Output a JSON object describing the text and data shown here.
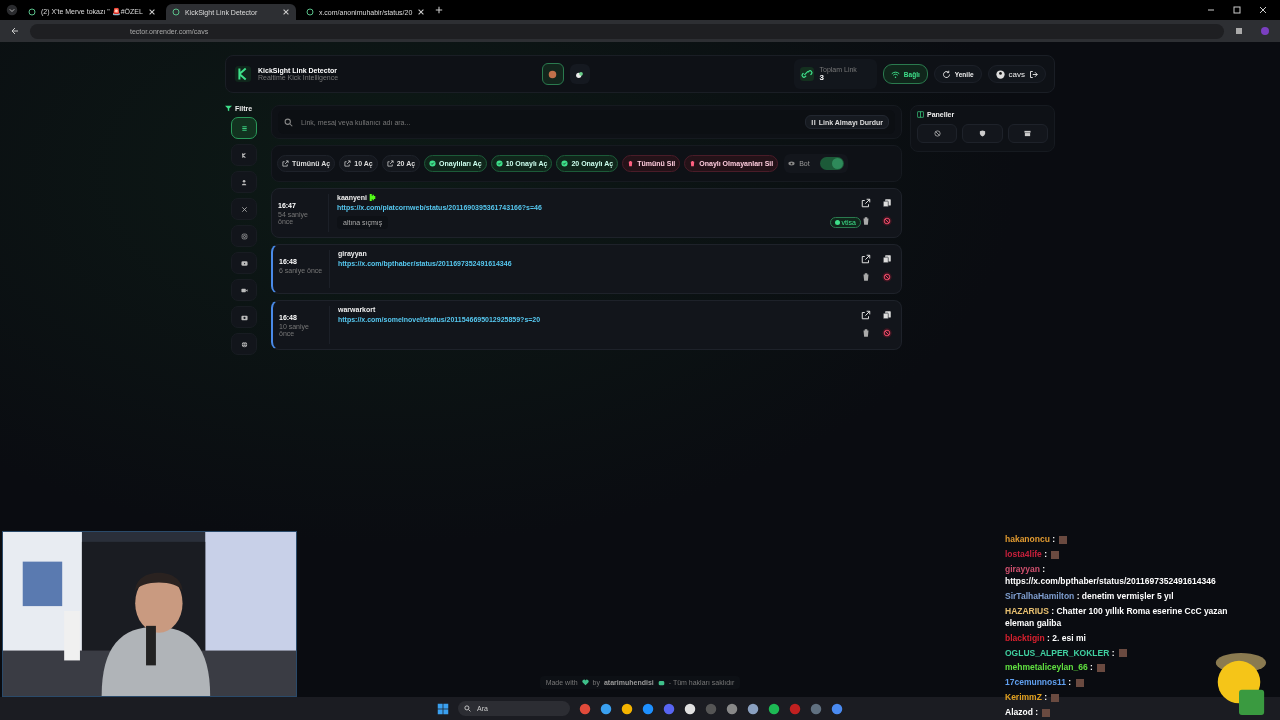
{
  "browser": {
    "tabs": [
      {
        "title": "(2) X'te Merve tokazı \" 🚨#ÖZEL",
        "selected": false
      },
      {
        "title": "KickSight Link Detector",
        "selected": true
      },
      {
        "title": "x.com/anonimuhabir/status/20",
        "selected": false
      }
    ],
    "address": "tector.onrender.com/cavs"
  },
  "header": {
    "title": "KickSight Link Detector",
    "subtitle": "Realtime Kick Intelligence",
    "stat_label": "Toplam Link",
    "stat_value": "3",
    "status": "Bağlı",
    "refresh": "Yenile",
    "user": "cavs"
  },
  "filter_title": "Filtre",
  "filters": [
    {
      "selected": true
    },
    {
      "selected": false
    },
    {
      "selected": false
    },
    {
      "selected": false
    },
    {
      "selected": false
    },
    {
      "selected": false
    },
    {
      "selected": false
    },
    {
      "selected": false
    },
    {
      "selected": false
    }
  ],
  "search": {
    "placeholder": "Link, mesaj veya kullanıcı adı ara...",
    "stop_button": "Link Almayı Durdur"
  },
  "actions": [
    {
      "label": "Tümünü Aç",
      "kind": "open"
    },
    {
      "label": "10 Aç",
      "kind": "open"
    },
    {
      "label": "20 Aç",
      "kind": "open"
    },
    {
      "label": "Onaylıları Aç",
      "kind": "approved"
    },
    {
      "label": "10 Onaylı Aç",
      "kind": "approved"
    },
    {
      "label": "20 Onaylı Aç",
      "kind": "approved"
    },
    {
      "label": "Tümünü Sil",
      "kind": "delete"
    },
    {
      "label": "Onaylı Olmayanları Sil",
      "kind": "delete"
    }
  ],
  "bot": {
    "label": "Bot",
    "on": true
  },
  "panels_title": "Paneller",
  "links": [
    {
      "time": "16:47",
      "ago": "54 saniye önce",
      "user": "kaanyeni",
      "verified": true,
      "url": "https://x.com/platcornweb/status/2011690395361743166?s=46",
      "note": "altına sıçmış",
      "badge": "vtisa",
      "unread": false
    },
    {
      "time": "16:48",
      "ago": "6 saniye önce",
      "user": "girayyan",
      "verified": false,
      "url": "https://x.com/bpthaber/status/2011697352491614346",
      "unread": true
    },
    {
      "time": "16:48",
      "ago": "10 saniye önce",
      "user": "warwarkort",
      "verified": false,
      "url": "https://x.com/somelnovel/status/2011546695012925859?s=20",
      "unread": true
    }
  ],
  "footer": {
    "made_with": "Made with",
    "by": "by",
    "author": "atarimuhendisi",
    "rights": "- Tüm hakları saklıdır"
  },
  "chat": [
    {
      "user": "hakanoncu",
      "sep": ":",
      "color": "#e09a30",
      "emote": true
    },
    {
      "user": "losta4life",
      "sep": ":",
      "color": "#c8203c",
      "emote": true
    },
    {
      "user": "girayyan",
      "sep": ":",
      "color": "#d0506e",
      "text": "https://x.com/bpthaber/status/2011697352491614346"
    },
    {
      "user": "SirTalhaHamilton",
      "sep": ":",
      "color": "#7f9fd0",
      "text": "denetim vermişler 5 yıl"
    },
    {
      "user": "HAZARIUS",
      "sep": ":",
      "color": "#e8c070",
      "text": "Chatter 100 yıllık Roma eserine CcC yazan eleman galiba"
    },
    {
      "user": "blacktigin",
      "sep": ":",
      "color": "#d8202e",
      "text": "2. esi mi"
    },
    {
      "user": "OGLUS_ALPER_KOKLER",
      "sep": ":",
      "color": "#40d0a0",
      "emote": true
    },
    {
      "user": "mehmetaliceylan_66",
      "sep": ":",
      "color": "#60e040",
      "emote": true
    },
    {
      "user": "17cemunnos11",
      "sep": ":",
      "color": "#60a0f0",
      "emote": true
    },
    {
      "user": "KerimmZ",
      "sep": ":",
      "color": "#e0a020",
      "emote": true
    },
    {
      "user": "Alazod",
      "sep": ":",
      "color": "#ffffff",
      "emote": true
    }
  ],
  "taskbar": {
    "search": "Ara"
  }
}
